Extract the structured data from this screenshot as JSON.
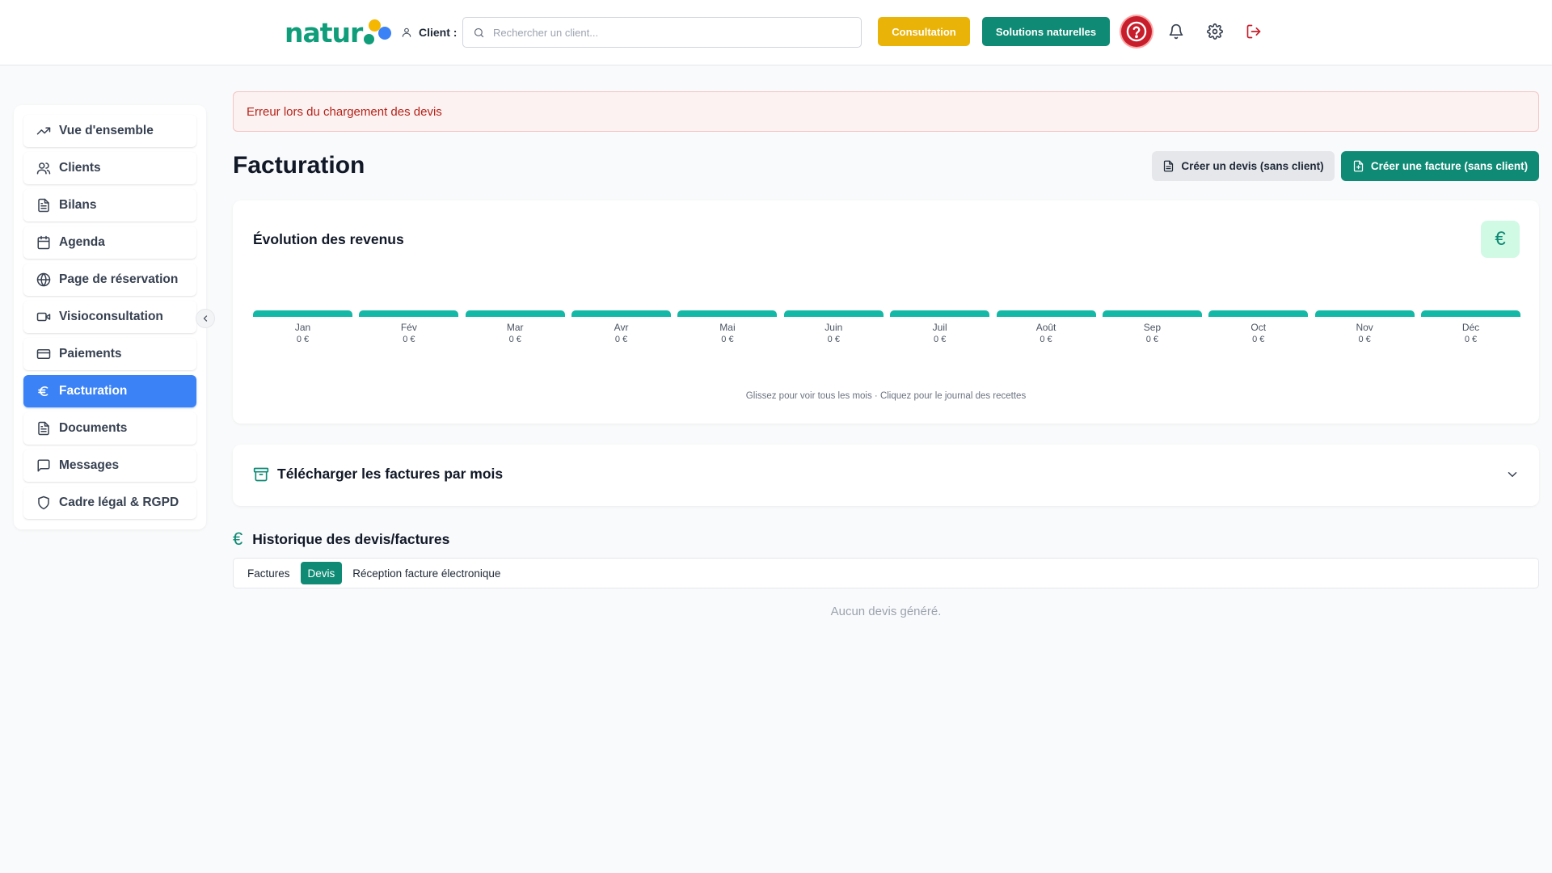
{
  "header": {
    "logo_text": "natur",
    "client_label": "Client :",
    "search_placeholder": "Rechercher un client...",
    "consultation_label": "Consultation",
    "solutions_label": "Solutions naturelles",
    "colors": {
      "yellow": "#eab308",
      "green": "#0f8a74",
      "red": "#c81e2b"
    }
  },
  "sidebar": {
    "items": [
      {
        "label": "Vue d'ensemble",
        "icon": "trending-up-icon"
      },
      {
        "label": "Clients",
        "icon": "users-icon"
      },
      {
        "label": "Bilans",
        "icon": "file-text-icon"
      },
      {
        "label": "Agenda",
        "icon": "calendar-icon"
      },
      {
        "label": "Page de réservation",
        "icon": "globe-icon"
      },
      {
        "label": "Visioconsultation",
        "icon": "video-icon"
      },
      {
        "label": "Paiements",
        "icon": "credit-card-icon"
      },
      {
        "label": "Facturation",
        "icon": "euro-icon",
        "active": true
      },
      {
        "label": "Documents",
        "icon": "file-text-icon"
      },
      {
        "label": "Messages",
        "icon": "message-square-icon"
      },
      {
        "label": "Cadre légal & RGPD",
        "icon": "shield-icon"
      }
    ],
    "active_color": "#3b82f6"
  },
  "main": {
    "error_message": "Erreur lors du chargement des devis",
    "page_title": "Facturation",
    "create_quote_label": "Créer un devis (sans client)",
    "create_invoice_label": "Créer une facture (sans client)",
    "revenue": {
      "title": "Évolution des revenus",
      "currency_symbol": "€",
      "hint": "Glissez pour voir tous les mois · Cliquez pour le journal des recettes"
    },
    "download": {
      "title": "Télécharger les factures par mois"
    },
    "history": {
      "title": "Historique des devis/factures",
      "currency_symbol": "€",
      "tabs": [
        {
          "label": "Factures",
          "active": false
        },
        {
          "label": "Devis",
          "active": true
        },
        {
          "label": "Réception facture électronique",
          "active": false
        }
      ],
      "empty_message": "Aucun devis généré."
    }
  },
  "chart_data": {
    "type": "bar",
    "categories": [
      "Jan",
      "Fév",
      "Mar",
      "Avr",
      "Mai",
      "Juin",
      "Juil",
      "Août",
      "Sep",
      "Oct",
      "Nov",
      "Déc"
    ],
    "values": [
      0,
      0,
      0,
      0,
      0,
      0,
      0,
      0,
      0,
      0,
      0,
      0
    ],
    "value_labels": [
      "0 €",
      "0 €",
      "0 €",
      "0 €",
      "0 €",
      "0 €",
      "0 €",
      "0 €",
      "0 €",
      "0 €",
      "0 €",
      "0 €"
    ],
    "title": "Évolution des revenus",
    "xlabel": "",
    "ylabel": "",
    "bar_color": "#14b8a6"
  }
}
